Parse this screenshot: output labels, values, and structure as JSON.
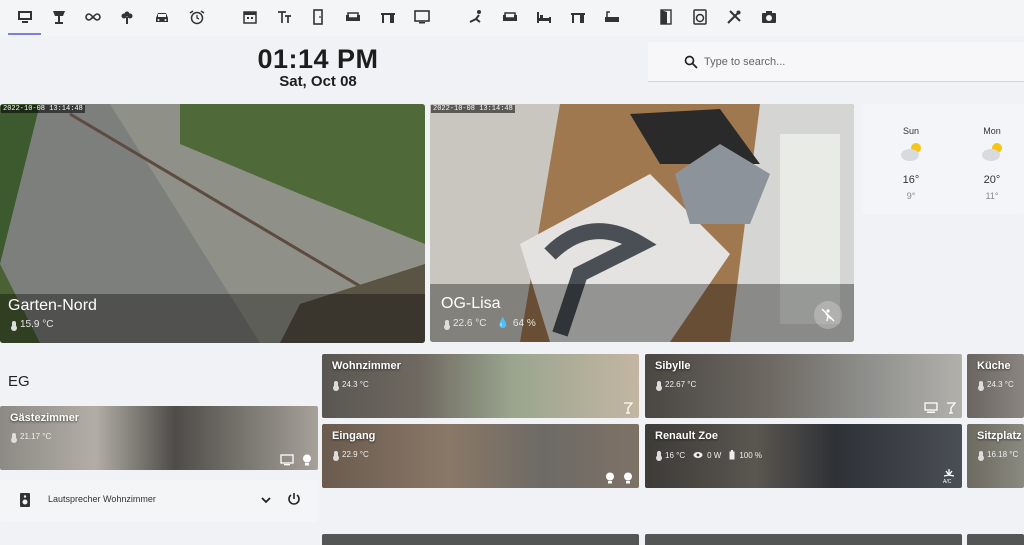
{
  "clock": {
    "time": "01:14 PM",
    "date": "Sat, Oct 08"
  },
  "search": {
    "placeholder": "Type to search..."
  },
  "top_icons": [
    "monitor-icon",
    "lamp-icon",
    "infinity-icon",
    "flower-icon",
    "car-icon",
    "alarm-icon",
    "calendar-icon",
    "text-icon",
    "door-icon",
    "sofa-icon",
    "desk-icon",
    "tv-icon",
    "person-rowing-icon",
    "sofa-icon",
    "bed-icon",
    "desk-icon",
    "bathtub-icon",
    "door-open-icon",
    "washer-icon",
    "tools-icon",
    "camera-icon"
  ],
  "cameras": [
    {
      "timestamp": "2022-10-08 13:14:48",
      "name": "Garten-Nord",
      "temp": "15.9 °C"
    },
    {
      "timestamp": "2022-10-08 13:14:48",
      "name": "OG-Lisa",
      "temp": "22.6 °C",
      "humidity": "64 %"
    }
  ],
  "weather": [
    {
      "day": "Sun",
      "high": "16°",
      "low": "9°"
    },
    {
      "day": "Mon",
      "high": "20°",
      "low": "11°"
    }
  ],
  "section": {
    "title": "EG"
  },
  "rooms": [
    {
      "name": "Gästezimmer",
      "temp": "21.17 °C"
    },
    {
      "name": "Wohnzimmer",
      "temp": "24.3 °C"
    },
    {
      "name": "Sibylle",
      "temp": "22.67 °C"
    },
    {
      "name": "Küche",
      "temp": "24.3 °C"
    },
    {
      "name": "Eingang",
      "temp": "22.9 °C"
    },
    {
      "name": "Renault Zoe",
      "temp": "16 °C",
      "power": "0 W",
      "battery": "100 %"
    },
    {
      "name": "Sitzplatz",
      "temp": "16.18 °C"
    }
  ],
  "speaker": {
    "label": "Lautsprecher Wohnzimmer"
  },
  "colors": {
    "accent": "#7e7fdc",
    "background": "#f1f2f5"
  }
}
